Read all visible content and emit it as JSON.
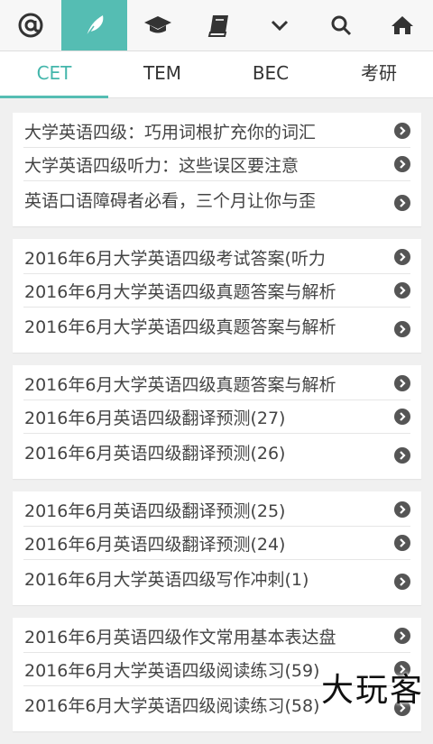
{
  "toolbar": {
    "icons": [
      "at-icon",
      "feather-icon",
      "graduation-cap-icon",
      "book-icon",
      "chevron-down-icon",
      "search-icon",
      "home-icon"
    ],
    "accent_color": "#55bdb3"
  },
  "tabs": [
    {
      "label": "CET",
      "active": true
    },
    {
      "label": "TEM",
      "active": false
    },
    {
      "label": "BEC",
      "active": false
    },
    {
      "label": "考研",
      "active": false
    }
  ],
  "cards": [
    {
      "items": [
        "大学英语四级：巧用词根扩充你的词汇",
        "大学英语四级听力：这些误区要注意",
        "英语口语障碍者必看，三个月让你与歪"
      ]
    },
    {
      "items": [
        "2016年6月大学英语四级考试答案(听力",
        "2016年6月大学英语四级真题答案与解析",
        "2016年6月大学英语四级真题答案与解析"
      ]
    },
    {
      "items": [
        "2016年6月大学英语四级真题答案与解析",
        "2016年6月英语四级翻译预测(27)",
        "2016年6月英语四级翻译预测(26)"
      ]
    },
    {
      "items": [
        "2016年6月英语四级翻译预测(25)",
        "2016年6月英语四级翻译预测(24)",
        "2016年6月大学英语四级写作冲刺(1)"
      ]
    },
    {
      "items": [
        "2016年6月英语四级作文常用基本表达盘",
        "2016年6月大学英语四级阅读练习(59)",
        "2016年6月大学英语四级阅读练习(58)"
      ]
    }
  ],
  "watermark": "大玩客"
}
